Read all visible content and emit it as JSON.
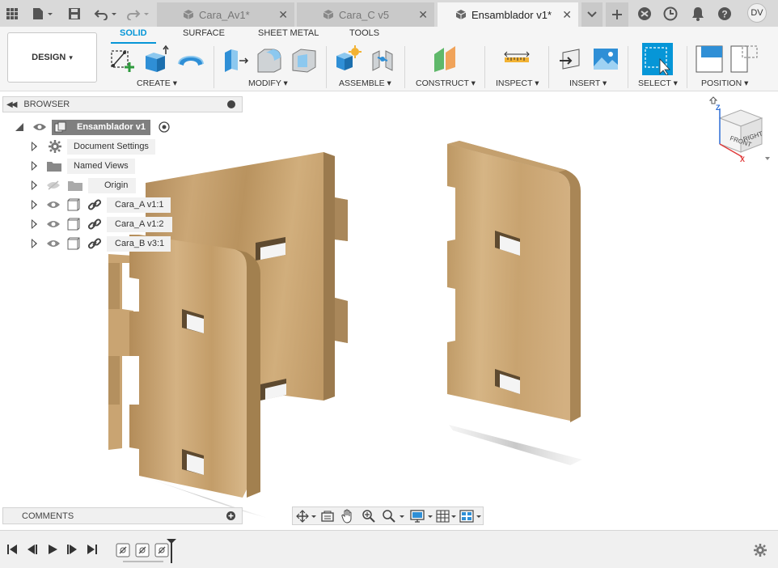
{
  "tabs": [
    {
      "label": "Cara_Av1*",
      "active": false
    },
    {
      "label": "Cara_C v5",
      "active": false
    },
    {
      "label": "Ensamblador v1*",
      "active": true
    }
  ],
  "user": {
    "initials": "DV"
  },
  "workspace": {
    "label": "DESIGN",
    "caret": "▾"
  },
  "ribbon_tabs": [
    "SOLID",
    "SURFACE",
    "SHEET METAL",
    "TOOLS"
  ],
  "tool_groups": [
    {
      "label": "CREATE ▾"
    },
    {
      "label": "MODIFY ▾"
    },
    {
      "label": "ASSEMBLE ▾"
    },
    {
      "label": "CONSTRUCT ▾"
    },
    {
      "label": "INSPECT ▾"
    },
    {
      "label": "INSERT ▾"
    },
    {
      "label": "SELECT ▾"
    },
    {
      "label": "POSITION ▾"
    }
  ],
  "browser": {
    "title": "BROWSER",
    "root": "Ensamblador v1",
    "items": [
      {
        "label": "Document Settings",
        "icon": "gear-icon"
      },
      {
        "label": "Named Views",
        "icon": "folder-icon"
      },
      {
        "label": "Origin",
        "icon": "folder-icon"
      },
      {
        "label": "Cara_A v1:1",
        "icon": "component-icon"
      },
      {
        "label": "Cara_A v1:2",
        "icon": "component-icon"
      },
      {
        "label": "Cara_B v3:1",
        "icon": "component-icon"
      }
    ]
  },
  "comments": {
    "title": "COMMENTS"
  },
  "viewcube": {
    "front": "FRONT",
    "right": "RIGHT",
    "z": "Z",
    "x": "X"
  },
  "colors": {
    "accent": "#0696d7",
    "wood": "#c9a472",
    "wood_dark": "#9c7b4e"
  }
}
